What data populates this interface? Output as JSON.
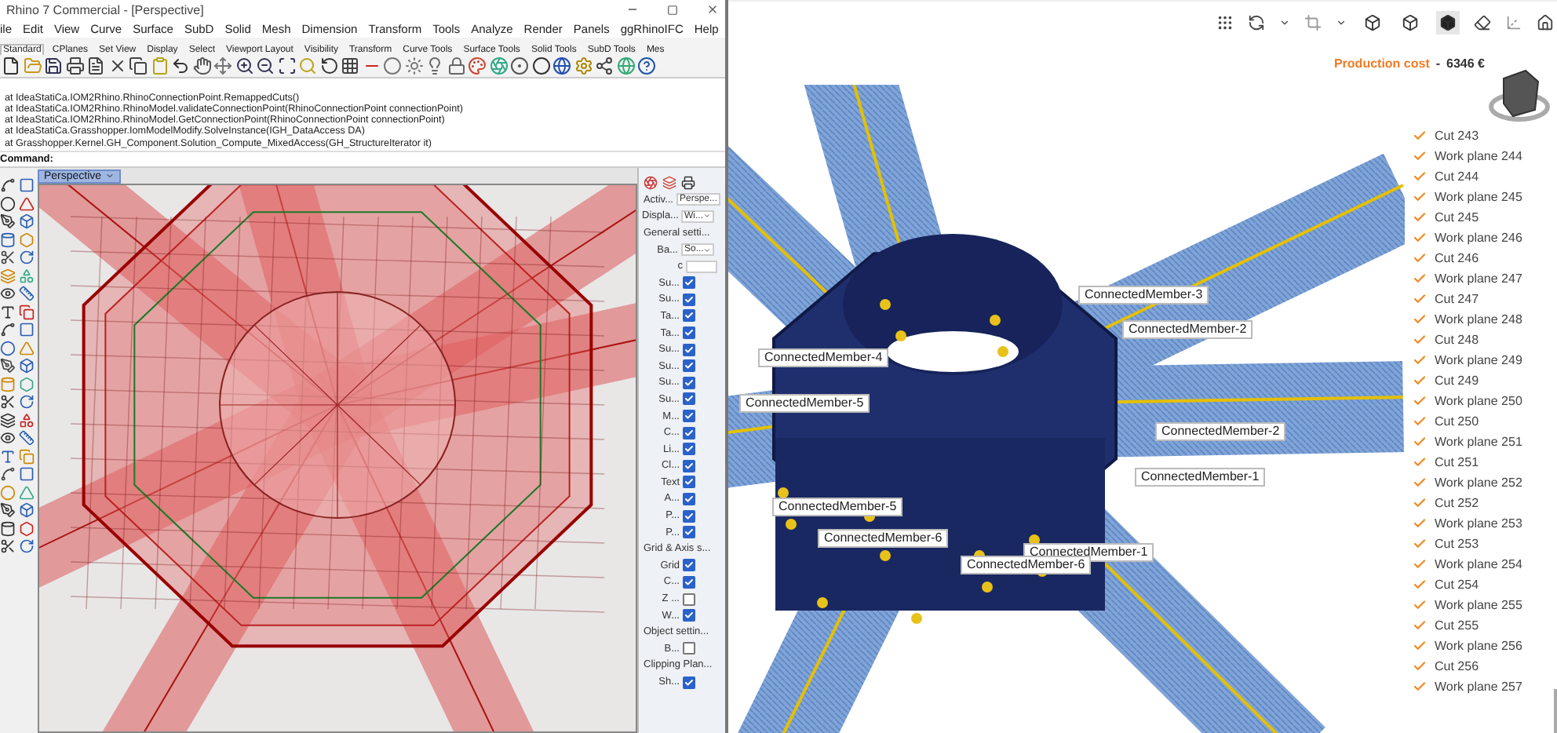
{
  "rhino": {
    "title": "Rhino 7 Commercial - [Perspective]",
    "menu": [
      "ile",
      "Edit",
      "View",
      "Curve",
      "Surface",
      "SubD",
      "Solid",
      "Mesh",
      "Dimension",
      "Transform",
      "Tools",
      "Analyze",
      "Render",
      "Panels",
      "ggRhinoIFC",
      "Help"
    ],
    "toolbar_tabs": [
      {
        "label": "Standard",
        "selected": true
      },
      {
        "label": "CPlanes",
        "selected": false
      },
      {
        "label": "Set View",
        "selected": false
      },
      {
        "label": "Display",
        "selected": false
      },
      {
        "label": "Select",
        "selected": false
      },
      {
        "label": "Viewport Layout",
        "selected": false
      },
      {
        "label": "Visibility",
        "selected": false
      },
      {
        "label": "Transform",
        "selected": false
      },
      {
        "label": "Curve Tools",
        "selected": false
      },
      {
        "label": "Surface Tools",
        "selected": false
      },
      {
        "label": "Solid Tools",
        "selected": false
      },
      {
        "label": "SubD Tools",
        "selected": false
      },
      {
        "label": "Mes",
        "selected": false
      }
    ],
    "history": [
      "at IdeaStatiCa.IOM2Rhino.RhinoConnectionPoint.RemappedCuts()",
      "at IdeaStatiCa.IOM2Rhino.RhinoModel.validateConnectionPoint(RhinoConnectionPoint connectionPoint)",
      "at IdeaStatiCa.IOM2Rhino.RhinoModel.GetConnectionPoint(RhinoConnectionPoint connectionPoint)",
      "at IdeaStatiCa.Grasshopper.IomModelModify.SolveInstance(IGH_DataAccess DA)",
      "at Grasshopper.Kernel.GH_Component.Solution_Compute_MixedAccess(GH_StructureIterator it)"
    ],
    "command_label": "Command:",
    "viewport_tab": "Perspective",
    "properties": [
      {
        "kind": "field",
        "label": "Activ...",
        "value": "Perspe..."
      },
      {
        "kind": "dropdown",
        "label": "Displa...",
        "value": "Wi..."
      },
      {
        "kind": "header",
        "label": "General setti..."
      },
      {
        "kind": "dropdown",
        "label": "Ba...",
        "value": "So..."
      },
      {
        "kind": "input",
        "label": "c"
      },
      {
        "kind": "checkbox",
        "label": "Su...",
        "checked": true
      },
      {
        "kind": "checkbox",
        "label": "Su...",
        "checked": true
      },
      {
        "kind": "checkbox",
        "label": "Ta...",
        "checked": true
      },
      {
        "kind": "checkbox",
        "label": "Ta...",
        "checked": true
      },
      {
        "kind": "checkbox",
        "label": "Su...",
        "checked": true
      },
      {
        "kind": "checkbox",
        "label": "Su...",
        "checked": true
      },
      {
        "kind": "checkbox",
        "label": "Su...",
        "checked": true
      },
      {
        "kind": "checkbox",
        "label": "Su...",
        "checked": true
      },
      {
        "kind": "checkbox",
        "label": "M...",
        "checked": true
      },
      {
        "kind": "checkbox",
        "label": "C...",
        "checked": true
      },
      {
        "kind": "checkbox",
        "label": "Li...",
        "checked": true
      },
      {
        "kind": "checkbox",
        "label": "Cl...",
        "checked": true
      },
      {
        "kind": "checkbox",
        "label": "Text",
        "checked": true
      },
      {
        "kind": "checkbox",
        "label": "A...",
        "checked": true
      },
      {
        "kind": "checkbox",
        "label": "P...",
        "checked": true
      },
      {
        "kind": "checkbox",
        "label": "P...",
        "checked": true
      },
      {
        "kind": "header",
        "label": "Grid & Axis s..."
      },
      {
        "kind": "checkbox",
        "label": "Grid",
        "checked": true
      },
      {
        "kind": "checkbox",
        "label": "C...",
        "checked": true
      },
      {
        "kind": "checkbox",
        "label": "Z ...",
        "checked": false
      },
      {
        "kind": "checkbox",
        "label": "W...",
        "checked": true
      },
      {
        "kind": "header",
        "label": "Object settin..."
      },
      {
        "kind": "checkbox",
        "label": "B...",
        "checked": false
      },
      {
        "kind": "header",
        "label": "Clipping Plan..."
      },
      {
        "kind": "checkbox",
        "label": "Sh...",
        "checked": true
      }
    ]
  },
  "idea": {
    "view_modes": [
      {
        "selected": false
      },
      {
        "selected": false
      },
      {
        "selected": true
      }
    ],
    "cost_label": "Production cost",
    "cost_separator": "-",
    "cost_value": "6346 €",
    "member_labels": [
      "ConnectedMember-3",
      "ConnectedMember-2",
      "ConnectedMember-4",
      "ConnectedMember-5",
      "ConnectedMember-2",
      "ConnectedMember-1",
      "ConnectedMember-5",
      "ConnectedMember-6",
      "ConnectedMember-1",
      "ConnectedMember-6"
    ],
    "items": [
      {
        "label": "Cut 243",
        "checked": true
      },
      {
        "label": "Work plane 244",
        "checked": true
      },
      {
        "label": "Cut 244",
        "checked": true
      },
      {
        "label": "Work plane 245",
        "checked": true
      },
      {
        "label": "Cut 245",
        "checked": true
      },
      {
        "label": "Work plane 246",
        "checked": true
      },
      {
        "label": "Cut 246",
        "checked": true
      },
      {
        "label": "Work plane 247",
        "checked": true
      },
      {
        "label": "Cut 247",
        "checked": true
      },
      {
        "label": "Work plane 248",
        "checked": true
      },
      {
        "label": "Cut 248",
        "checked": true
      },
      {
        "label": "Work plane 249",
        "checked": true
      },
      {
        "label": "Cut 249",
        "checked": true
      },
      {
        "label": "Work plane 250",
        "checked": true
      },
      {
        "label": "Cut 250",
        "checked": true
      },
      {
        "label": "Work plane 251",
        "checked": true
      },
      {
        "label": "Cut 251",
        "checked": true
      },
      {
        "label": "Work plane 252",
        "checked": true
      },
      {
        "label": "Cut 252",
        "checked": true
      },
      {
        "label": "Work plane 253",
        "checked": true
      },
      {
        "label": "Cut 253",
        "checked": true
      },
      {
        "label": "Work plane 254",
        "checked": true
      },
      {
        "label": "Cut 254",
        "checked": true
      },
      {
        "label": "Work plane 255",
        "checked": true
      },
      {
        "label": "Cut 255",
        "checked": true
      },
      {
        "label": "Work plane 256",
        "checked": true
      },
      {
        "label": "Cut 256",
        "checked": true
      },
      {
        "label": "Work plane 257",
        "checked": true
      }
    ]
  }
}
